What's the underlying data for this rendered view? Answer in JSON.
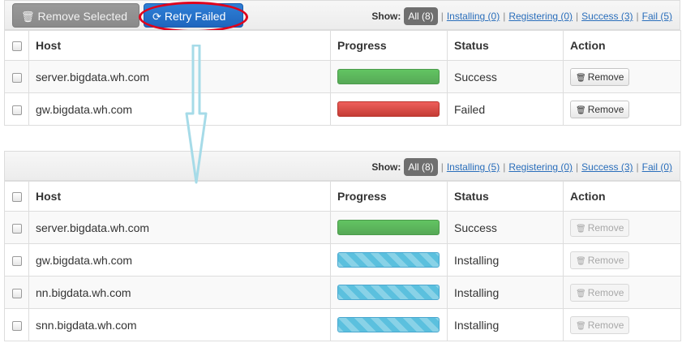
{
  "top": {
    "remove_selected_label": "Remove Selected",
    "retry_failed_label": "Retry Failed",
    "filters": {
      "show_label": "Show:",
      "all": "All (8)",
      "installing": "Installing (0)",
      "registering": "Registering (0)",
      "success": "Success (3)",
      "fail": "Fail (5)"
    },
    "table": {
      "headers": {
        "host": "Host",
        "progress": "Progress",
        "status": "Status",
        "action": "Action"
      },
      "rows": [
        {
          "host": "server.bigdata.wh.com",
          "progress": "success",
          "status": "Success",
          "action": "Remove"
        },
        {
          "host": "gw.bigdata.wh.com",
          "progress": "failed",
          "status": "Failed",
          "action": "Remove"
        }
      ]
    }
  },
  "bottom": {
    "filters": {
      "show_label": "Show:",
      "all": "All (8)",
      "installing": "Installing (5)",
      "registering": "Registering (0)",
      "success": "Success (3)",
      "fail": "Fail (0)"
    },
    "table": {
      "headers": {
        "host": "Host",
        "progress": "Progress",
        "status": "Status",
        "action": "Action"
      },
      "rows": [
        {
          "host": "server.bigdata.wh.com",
          "progress": "success",
          "status": "Success",
          "action": "Remove"
        },
        {
          "host": "gw.bigdata.wh.com",
          "progress": "installing",
          "status": "Installing",
          "action": "Remove"
        },
        {
          "host": "nn.bigdata.wh.com",
          "progress": "installing",
          "status": "Installing",
          "action": "Remove"
        },
        {
          "host": "snn.bigdata.wh.com",
          "progress": "installing",
          "status": "Installing",
          "action": "Remove"
        }
      ]
    }
  },
  "colors": {
    "retry_button": "#1f66be",
    "annotation_ellipse": "#e0001b",
    "annotation_arrow": "#a6dbe8",
    "success": "#57a957",
    "failed": "#c43c35",
    "installing": "#5bc0de"
  },
  "icons": {
    "remove_selected": "trash-icon",
    "retry": "refresh-icon",
    "remove": "trash-icon"
  }
}
